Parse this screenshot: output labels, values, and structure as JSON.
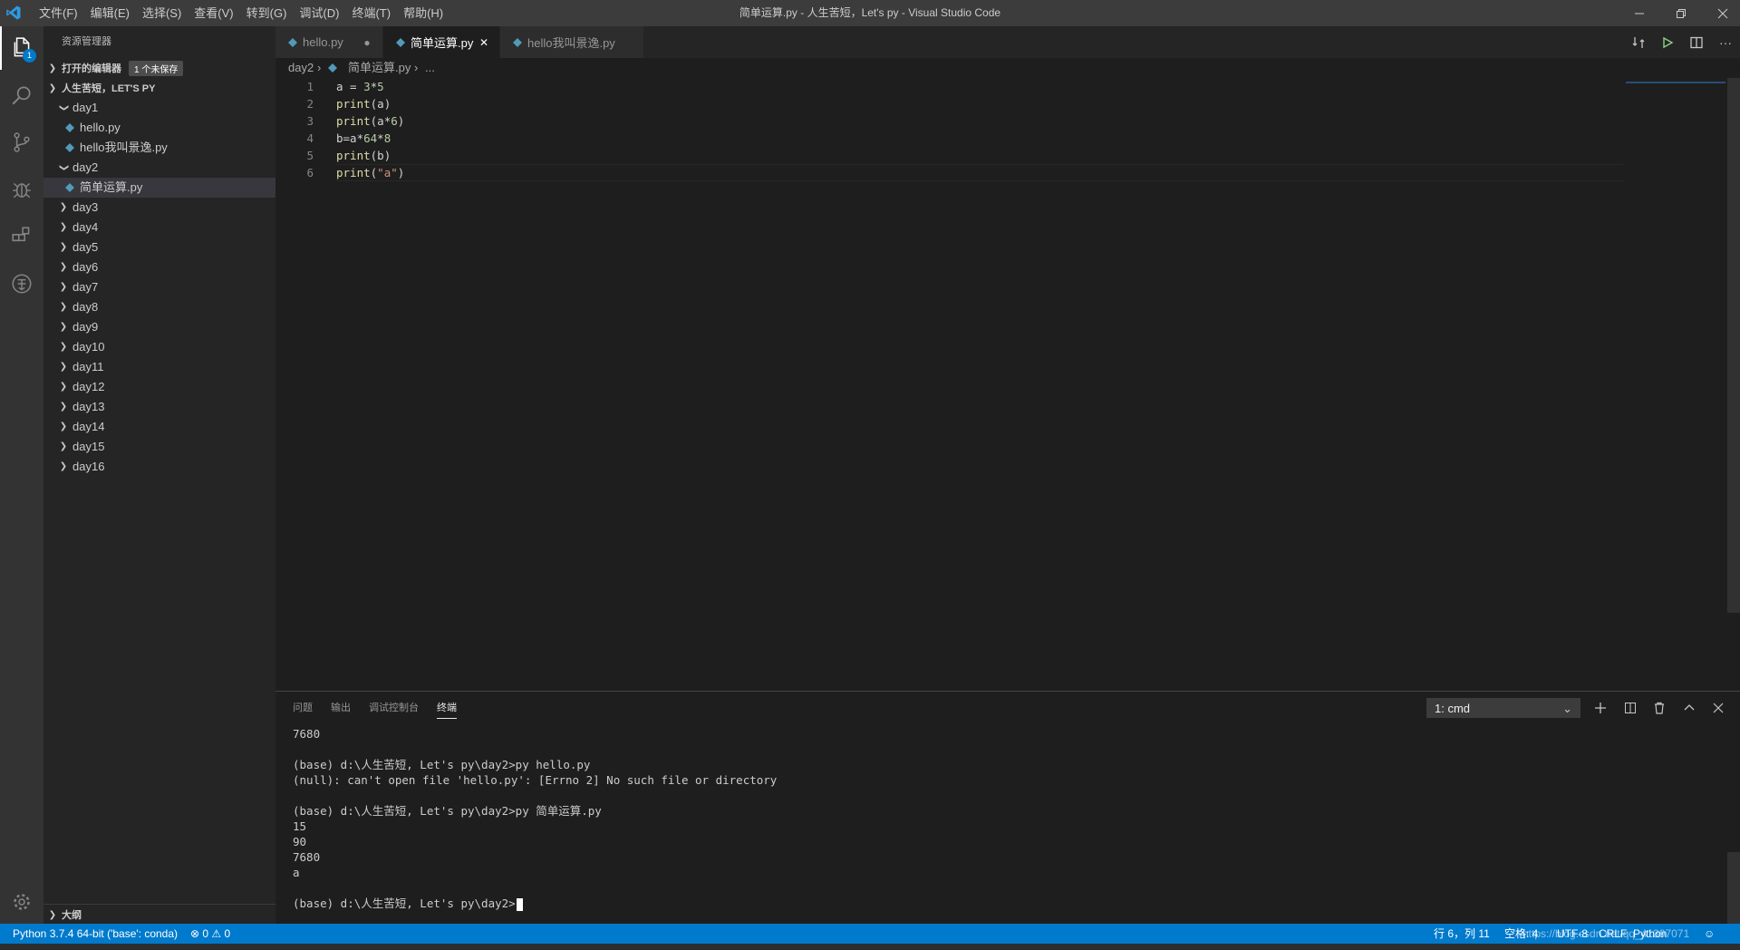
{
  "titlebar": {
    "menus": [
      "文件(F)",
      "编辑(E)",
      "选择(S)",
      "查看(V)",
      "转到(G)",
      "调试(D)",
      "终端(T)",
      "帮助(H)"
    ],
    "title": "简单运算.py - 人生苦短，Let's py - Visual Studio Code"
  },
  "activitybar": {
    "explorer_badge": "1"
  },
  "sidebar": {
    "title": "资源管理器",
    "open_editors": "打开的编辑器",
    "unsaved_badge": "1 个未保存",
    "workspace": "人生苦短，LET'S PY",
    "tree": [
      {
        "label": "day1",
        "kind": "folder-open",
        "depth": 1
      },
      {
        "label": "hello.py",
        "kind": "file",
        "depth": 2
      },
      {
        "label": "hello我叫景逸.py",
        "kind": "file",
        "depth": 2
      },
      {
        "label": "day2",
        "kind": "folder-open",
        "depth": 1
      },
      {
        "label": "简单运算.py",
        "kind": "file",
        "depth": 2,
        "selected": true
      },
      {
        "label": "day3",
        "kind": "folder",
        "depth": 1
      },
      {
        "label": "day4",
        "kind": "folder",
        "depth": 1
      },
      {
        "label": "day5",
        "kind": "folder",
        "depth": 1
      },
      {
        "label": "day6",
        "kind": "folder",
        "depth": 1
      },
      {
        "label": "day7",
        "kind": "folder",
        "depth": 1
      },
      {
        "label": "day8",
        "kind": "folder",
        "depth": 1
      },
      {
        "label": "day9",
        "kind": "folder",
        "depth": 1
      },
      {
        "label": "day10",
        "kind": "folder",
        "depth": 1
      },
      {
        "label": "day11",
        "kind": "folder",
        "depth": 1
      },
      {
        "label": "day12",
        "kind": "folder",
        "depth": 1
      },
      {
        "label": "day13",
        "kind": "folder",
        "depth": 1
      },
      {
        "label": "day14",
        "kind": "folder",
        "depth": 1
      },
      {
        "label": "day15",
        "kind": "folder",
        "depth": 1
      },
      {
        "label": "day16",
        "kind": "folder",
        "depth": 1
      }
    ],
    "outline": "大纲"
  },
  "tabs": [
    {
      "label": "hello.py",
      "state": "dirty"
    },
    {
      "label": "简单运算.py",
      "state": "active"
    },
    {
      "label": "hello我叫景逸.py",
      "state": "normal"
    }
  ],
  "breadcrumb": {
    "folder": "day2",
    "file": "简单运算.py",
    "more": "..."
  },
  "editor": {
    "line_numbers": [
      "1",
      "2",
      "3",
      "4",
      "5",
      "6"
    ],
    "lines": [
      [
        {
          "t": "a = ",
          "c": ""
        },
        {
          "t": "3",
          "c": "num"
        },
        {
          "t": "*",
          "c": ""
        },
        {
          "t": "5",
          "c": "num"
        }
      ],
      [
        {
          "t": "print",
          "c": "kw"
        },
        {
          "t": "(a)",
          "c": ""
        }
      ],
      [
        {
          "t": "print",
          "c": "kw"
        },
        {
          "t": "(a*",
          "c": ""
        },
        {
          "t": "6",
          "c": "num"
        },
        {
          "t": ")",
          "c": ""
        }
      ],
      [
        {
          "t": "b=a*",
          "c": ""
        },
        {
          "t": "64",
          "c": "num"
        },
        {
          "t": "*",
          "c": ""
        },
        {
          "t": "8",
          "c": "num"
        }
      ],
      [
        {
          "t": "print",
          "c": "kw"
        },
        {
          "t": "(b)",
          "c": ""
        }
      ],
      [
        {
          "t": "print",
          "c": "kw"
        },
        {
          "t": "(",
          "c": ""
        },
        {
          "t": "\"a\"",
          "c": "str"
        },
        {
          "t": ")",
          "c": ""
        }
      ]
    ]
  },
  "panel": {
    "tabs": [
      "问题",
      "输出",
      "调试控制台",
      "终端"
    ],
    "active_tab": "终端",
    "terminal_select": "1: cmd",
    "terminal_lines": [
      "7680",
      "",
      "(base) d:\\人生苦短, Let's py\\day2>py hello.py",
      "(null): can't open file 'hello.py': [Errno 2] No such file or directory",
      "",
      "(base) d:\\人生苦短, Let's py\\day2>py 简单运算.py",
      "15",
      "90",
      "7680",
      "a",
      "",
      "(base) d:\\人生苦短, Let's py\\day2>"
    ]
  },
  "statusbar": {
    "interpreter": "Python 3.7.4 64-bit ('base': conda)",
    "problems": "⊗ 0 ⚠ 0",
    "position": "行 6，列 11",
    "spaces": "空格: 4",
    "encoding": "UTF-8",
    "eol": "CRLF",
    "language": "Python",
    "watermark": "https://blog.csdn.net/qq_41397071"
  }
}
